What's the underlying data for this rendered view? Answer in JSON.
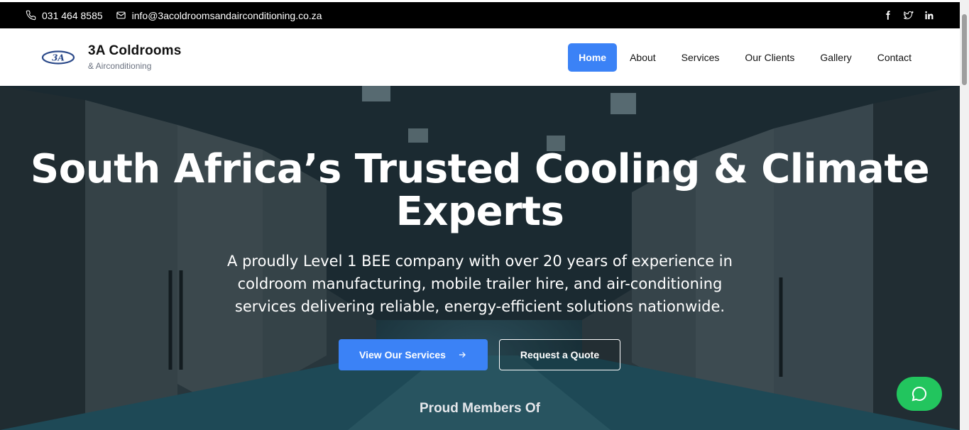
{
  "topbar": {
    "phone": "031 464 8585",
    "email": "info@3acoldroomsandairconditioning.co.za",
    "icons": [
      "phone-icon",
      "mail-icon",
      "facebook-icon",
      "twitter-icon",
      "linkedin-icon"
    ]
  },
  "brand": {
    "logo_text": "3A",
    "name": "3A Coldrooms",
    "sub": "& Airconditioning"
  },
  "nav": {
    "items": [
      {
        "label": "Home",
        "active": true
      },
      {
        "label": "About"
      },
      {
        "label": "Services"
      },
      {
        "label": "Our Clients"
      },
      {
        "label": "Gallery"
      },
      {
        "label": "Contact"
      }
    ]
  },
  "hero": {
    "title": "South Africa’s Trusted Cooling & Climate Experts",
    "text": "A proudly Level 1 BEE company with over 20 years of experience in coldroom manufacturing, mobile trailer hire, and air-conditioning services delivering reliable, energy-efficient solutions nationwide.",
    "primary_button": "View Our Services",
    "secondary_button": "Request a Quote",
    "members_heading": "Proud Members Of"
  },
  "colors": {
    "accent": "#3b82f6",
    "chat": "#22c55e",
    "topbar": "#000000"
  }
}
